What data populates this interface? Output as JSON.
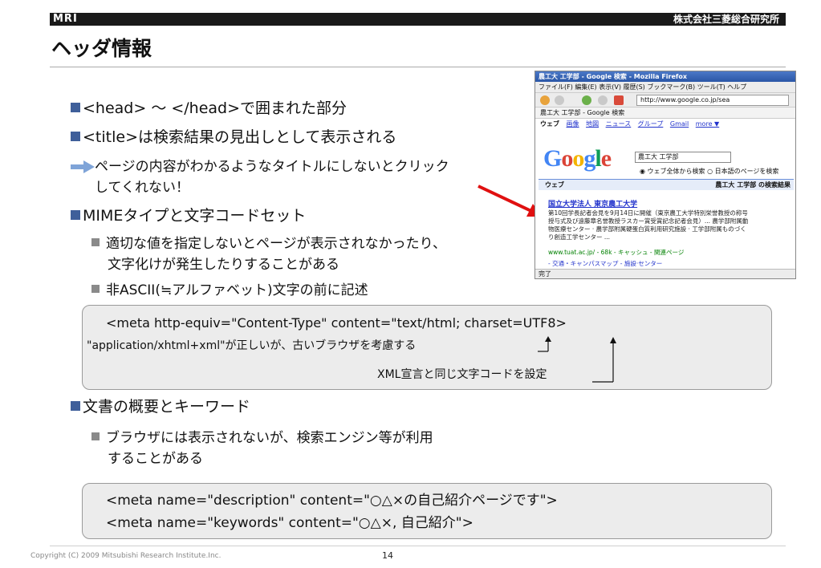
{
  "header": {
    "logo": "MRI",
    "company": "株式会社三菱総合研究所"
  },
  "slide": {
    "title": "ヘッダ情報",
    "bullet1": "<head> ～ </head>で囲まれた部分",
    "bullet2": "<title>は検索結果の見出しとして表示される",
    "arrow_line1": "ページの内容がわかるようなタイトルにしないとクリック",
    "arrow_line2": "してくれない！",
    "bullet3": "MIMEタイプと文字コードセット",
    "sub1_line1": "適切な値を指定しないとページが表示されなかったり、",
    "sub1_line2": "文字化けが発生したりすることがある",
    "sub2": "非ASCII(≒アルファベット)文字の前に記述",
    "code1": "<meta http-equiv=\"Content-Type\" content=\"text/html; charset=UTF8>",
    "note1": "\"application/xhtml+xml\"が正しいが、古いブラウザを考慮する",
    "note2": "XML宣言と同じ文字コードを設定",
    "bullet4": "文書の概要とキーワード",
    "sub3_line1": "ブラウザには表示されないが、検索エンジン等が利用",
    "sub3_line2": "することがある",
    "code2": "<meta name=\"description\" content=\"○△×の自己紹介ページです\">",
    "code3": "<meta name=\"keywords\" content=\"○△×, 自己紹介\">"
  },
  "browser": {
    "window_title": "農工大 工学部 - Google 検索 - Mozilla Firefox",
    "menu": "ファイル(F)  編集(E)  表示(V)  履歴(S)  ブックマーク(B)  ツール(T)  ヘルプ",
    "url": "http://www.google.co.jp/sea",
    "tab": "農工大 工学部 - Google 検索",
    "nav_web": "ウェブ",
    "nav_links": [
      "画像",
      "地図",
      "ニュース",
      "グループ",
      "Gmail",
      "more ▼"
    ],
    "logo": "Google",
    "query": "農工大 工学部",
    "radio": "◉ ウェブ全体から検索  ○ 日本語のページを検索",
    "bar_left": "ウェブ",
    "bar_right": "農工大 工学部 の検索結果",
    "result_title": "国立大学法人 東京農工大学",
    "snippet1": "第10回学長記者会見を9月14日に開催（東京農工大学特別栄誉教授の称号",
    "snippet2": "授与式及び遠藤章名誉教授ラスカー賞受賞記念記者会見）... 農学部附属動",
    "snippet3": "物医療センター · 農学部附属硬蛋白質利用研究施設 · 工学部附属ものづく",
    "snippet4": "り創造工学センター ...",
    "result_url": "www.tuat.ac.jp/ - 68k - キャッシュ - 関連ページ",
    "next_line": "- 交通・キャンパスマップ - 施設·センター",
    "status": "完了",
    "colors": {
      "blue": "#4285f4",
      "red": "#db4437",
      "yellow": "#f4b400",
      "green": "#0f9d58"
    }
  },
  "footer": {
    "copyright": "Copyright (C) 2009 Mitsubishi Research Institute.Inc.",
    "page": "14"
  }
}
